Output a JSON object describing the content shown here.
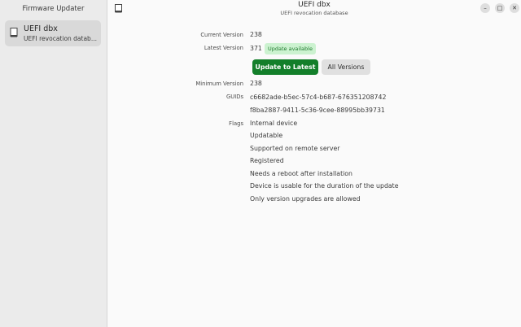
{
  "sidebar": {
    "title": "Firmware Updater",
    "device": {
      "name": "UEFI dbx",
      "description": "UEFI revocation datab..."
    }
  },
  "header": {
    "title": "UEFI dbx",
    "subtitle": "UEFI revocation database",
    "minimize": "–",
    "maximize": "□",
    "close": "✕"
  },
  "details": {
    "current_version_label": "Current Version",
    "current_version": "238",
    "latest_version_label": "Latest Version",
    "latest_version": "371",
    "update_badge": "Update available",
    "update_button": "Update to Latest",
    "all_versions_button": "All Versions",
    "minimum_version_label": "Minimum Version",
    "minimum_version": "238",
    "guids_label": "GUIDs",
    "guids": [
      "c6682ade-b5ec-57c4-b687-676351208742",
      "f8ba2887-9411-5c36-9cee-88995bb39731"
    ],
    "flags_label": "Flags",
    "flags": [
      "Internal device",
      "Updatable",
      "Supported on remote server",
      "Registered",
      "Needs a reboot after installation",
      "Device is usable for the duration of the update",
      "Only version upgrades are allowed"
    ]
  },
  "colors": {
    "accent": "#137f2a",
    "badge_bg": "#ccf2d0",
    "badge_text": "#1e7a2d"
  }
}
